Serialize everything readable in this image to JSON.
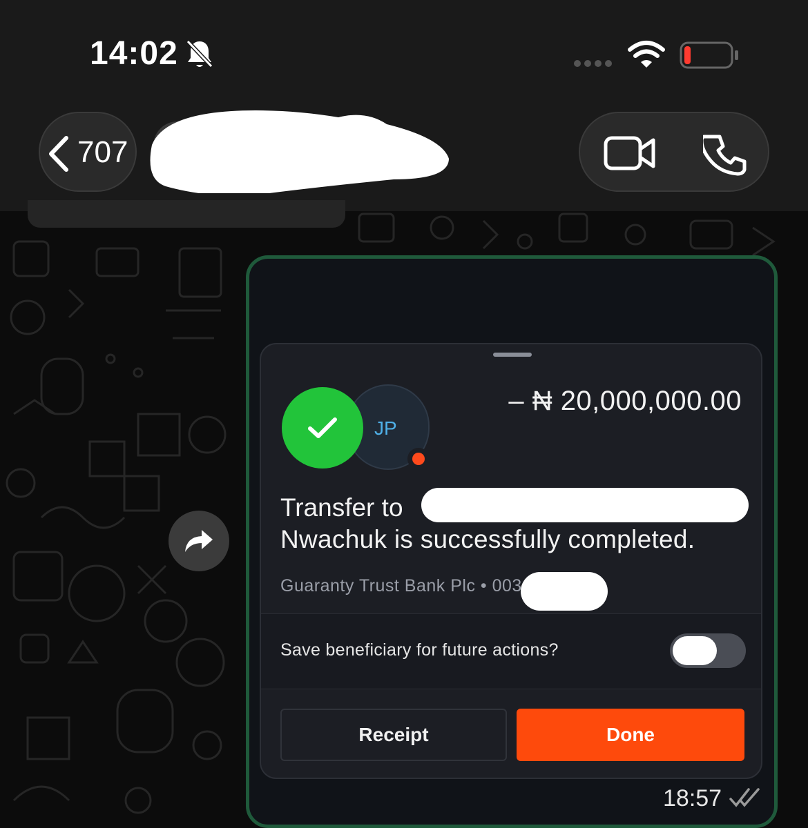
{
  "status_bar": {
    "time": "14:02",
    "battery_level": 0.08
  },
  "chat_header": {
    "back_count": "707"
  },
  "message": {
    "sheet": {
      "avatar_initials": "JP",
      "amount": "– ₦ 20,000,000.00",
      "transfer_prefix": "Transfer to",
      "transfer_line2": "Nwachuk is successfully completed.",
      "bank_info": "Guaranty Trust Bank Plc • 003",
      "save_beneficiary_label": "Save beneficiary for future actions?",
      "save_beneficiary_on": false,
      "receipt_label": "Receipt",
      "done_label": "Done"
    },
    "time": "18:57"
  },
  "colors": {
    "success": "#22c43a",
    "accent": "#fe4a0c",
    "bubble_border": "#1f5a3b"
  }
}
